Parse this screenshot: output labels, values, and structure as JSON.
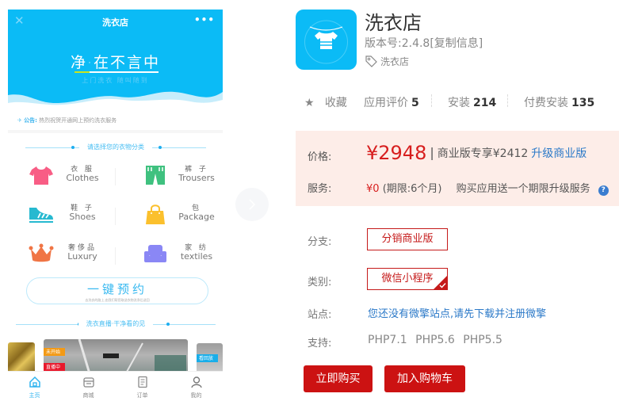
{
  "preview": {
    "title": "洗衣店",
    "close_icon": "close-icon",
    "more_label": "•••",
    "slogan": "净·在不言中",
    "slogan_sub": "上门洗衣  随叫随到",
    "notice_icon": "✈",
    "notice_label": "公告:",
    "notice_text": "热烈祝贺开通网上预约洗衣服务",
    "category_title": "请选择您的衣物分类",
    "categories": [
      {
        "cn": "衣 服",
        "en": "Clothes",
        "icon": "tshirt-icon",
        "color": "#f85d85"
      },
      {
        "cn": "裤 子",
        "en": "Trousers",
        "icon": "trousers-icon",
        "color": "#3fc17f"
      },
      {
        "cn": "鞋 子",
        "en": "Shoes",
        "icon": "shoe-icon",
        "color": "#27b9d0"
      },
      {
        "cn": "包",
        "en": "Package",
        "icon": "bag-icon",
        "color": "#fbc02d"
      },
      {
        "cn": "奢侈品",
        "en": "Luxury",
        "icon": "crown-icon",
        "color": "#f07545"
      },
      {
        "cn": "家 纺",
        "en": "textiles",
        "icon": "sofa-icon",
        "color": "#8a87f5"
      }
    ],
    "book_label": "一键预约",
    "book_sub": "去洗衣的路上,由我们帮您取送衣物洗净后送回",
    "live_title": "洗衣直播·干净看的见",
    "live_tags": {
      "not_started": "未开始",
      "live": "直播中",
      "replay": "看回放"
    },
    "tabs": [
      {
        "label": "主页",
        "icon": "home-icon",
        "active": true
      },
      {
        "label": "商城",
        "icon": "store-icon",
        "active": false
      },
      {
        "label": "订单",
        "icon": "order-icon",
        "active": false
      },
      {
        "label": "我的",
        "icon": "user-icon",
        "active": false
      }
    ]
  },
  "app": {
    "title": "洗衣店",
    "version": "版本号:2.4.8[复制信息]",
    "tag": "洗衣店",
    "icon_color": "#0bbbf6"
  },
  "stats": {
    "favorite_icon": "★",
    "favorite_label": "收藏",
    "rating_label": "应用评价",
    "rating_value": "5",
    "installs_label": "安装",
    "installs_value": "214",
    "paid_installs_label": "付费安装",
    "paid_installs_value": "135"
  },
  "pricing": {
    "price_label": "价格:",
    "price": "¥2948",
    "separator": "|",
    "business_text": "商业版专享¥2412",
    "upgrade_link": "升级商业版",
    "service_label": "服务:",
    "service_amount": "¥0",
    "service_period": "(期限:6个月)",
    "service_desc": "购买应用送一个期限升级服务",
    "help_icon": "?",
    "price_color": "#d71e1e",
    "bg_color": "#fdede8"
  },
  "options": {
    "branch_label": "分支:",
    "branch_value": "分销商业版",
    "category_label": "类别:",
    "category_value": "微信小程序",
    "site_label": "站点:",
    "site_text": "您还没有微擎站点,请先下载并注册微擎",
    "support_label": "支持:",
    "support_values": "PHP7.1 PHP5.6 PHP5.5"
  },
  "actions": {
    "buy_now": "立即购买",
    "add_to_cart": "加入购物车",
    "button_color": "#cc1212"
  }
}
